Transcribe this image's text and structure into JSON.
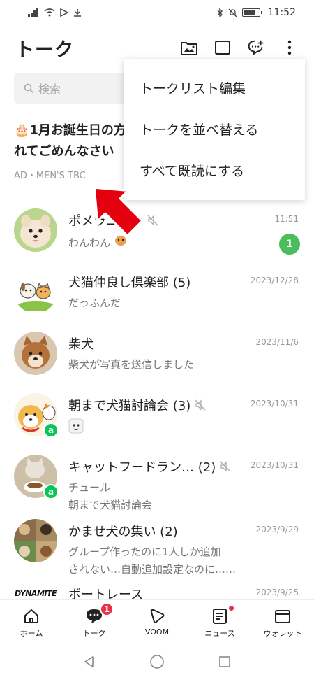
{
  "status_bar": {
    "time": "11:52"
  },
  "header": {
    "title": "トーク"
  },
  "search": {
    "placeholder": "検索"
  },
  "ad": {
    "title_line1": "🎂1月お誕生日の方",
    "title_line2": "れてごめんなさい",
    "sponsor": "AD・MEN'S TBC"
  },
  "menu": {
    "items": [
      "トークリスト編集",
      "トークを並べ替える",
      "すべて既読にする"
    ]
  },
  "chats": [
    {
      "name": "ポメラニアン",
      "message": "わんわん",
      "time": "11:51",
      "unread": "1",
      "muted": true
    },
    {
      "name": "犬猫仲良し倶楽部 (5)",
      "message": "だっふんだ",
      "time": "2023/12/28"
    },
    {
      "name": "柴犬",
      "message": "柴犬が写真を送信しました",
      "time": "2023/11/6"
    },
    {
      "name": "朝まで犬猫討論会 (3)",
      "message": "",
      "time": "2023/10/31",
      "muted": true
    },
    {
      "name": "キャットフードラン… (2)",
      "message": "チュール",
      "message2": "朝まで犬猫討論会",
      "time": "2023/10/31",
      "muted": true
    },
    {
      "name": "かませ犬の集い (2)",
      "message": "グループ作ったのに1人しか追加",
      "message2": "されない…自動追加設定なのに……",
      "time": "2023/9/29"
    },
    {
      "name": "ボートレース",
      "avatar_text": "DYNAMITE",
      "time": "2023/9/25"
    }
  ],
  "tabs": [
    {
      "label": "ホーム"
    },
    {
      "label": "トーク",
      "badge": "1"
    },
    {
      "label": "VOOM"
    },
    {
      "label": "ニュース"
    },
    {
      "label": "ウォレット"
    }
  ],
  "colors": {
    "accent_green": "#06c755",
    "badge_red": "#e9304a",
    "unread_green": "#4bbd5c",
    "arrow_red": "#e4000f"
  }
}
